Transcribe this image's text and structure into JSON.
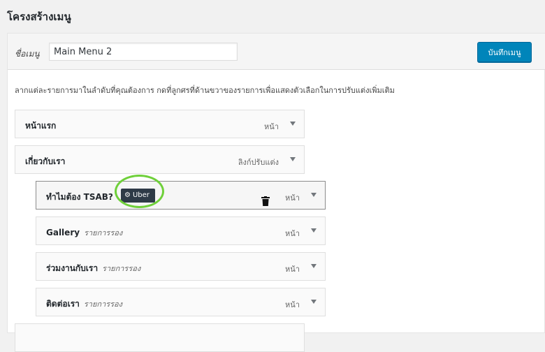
{
  "page": {
    "title": "โครงสร้างเมนู"
  },
  "menu_header": {
    "name_label": "ชื่อเมนู",
    "name_value": "Main Menu 2",
    "save_label": "บันทึกเมนู"
  },
  "instructions": "ลากแต่ละรายการมาในลำดับที่คุณต้องการ กดที่ลูกศรที่ด้านขวาของรายการเพื่อแสดงตัวเลือกในการปรับแต่งเพิ่มเติม",
  "items": [
    {
      "title": "หน้าแรก",
      "sub": "",
      "type": "หน้า",
      "depth": 0
    },
    {
      "title": "เกี่ยวกับเรา",
      "sub": "",
      "type": "ลิงก์ปรับแต่ง",
      "depth": 0
    },
    {
      "title": "ทำไมต้อง TSAB?",
      "sub": "",
      "type": "หน้า",
      "depth": 1,
      "badge": "Uber"
    },
    {
      "title": "Gallery",
      "sub": "รายการรอง",
      "type": "หน้า",
      "depth": 1
    },
    {
      "title": "ร่วมงานกับเรา",
      "sub": "รายการรอง",
      "type": "หน้า",
      "depth": 1
    },
    {
      "title": "ติดต่อเรา",
      "sub": "รายการรอง",
      "type": "หน้า",
      "depth": 1
    }
  ],
  "colors": {
    "primary_button": "#0085ba",
    "badge_background": "#2e3a47",
    "highlight_ring": "#6fd03a"
  },
  "icons": {
    "badge_icon": "gear-icon",
    "delete_icon": "trash-icon",
    "expand_icon": "chevron-down-icon"
  }
}
